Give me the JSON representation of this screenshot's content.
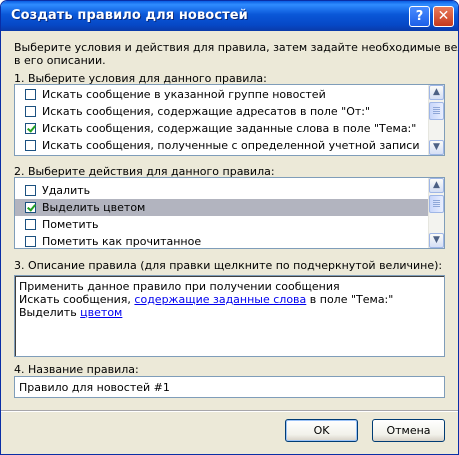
{
  "window": {
    "title": "Создать правило для новостей",
    "help_label": "?",
    "close_label": "✕"
  },
  "intro": {
    "line1": "Выберите условия и действия для правила, затем задайте необходимые величины",
    "line2": "в его описании."
  },
  "conditions": {
    "label": "1. Выберите условия для данного правила:",
    "items": [
      {
        "label": "Искать сообщение в указанной группе новостей",
        "checked": false
      },
      {
        "label": "Искать сообщения, содержащие адресатов в поле \"От:\"",
        "checked": false
      },
      {
        "label": "Искать сообщения, содержащие заданные слова в поле \"Тема:\"",
        "checked": true
      },
      {
        "label": "Искать сообщения, полученные с определенной учетной записи",
        "checked": false
      }
    ]
  },
  "actions": {
    "label": "2. Выберите действия для данного правила:",
    "items": [
      {
        "label": "Удалить",
        "checked": false
      },
      {
        "label": "Выделить цветом",
        "checked": true,
        "selected": true
      },
      {
        "label": "Пометить",
        "checked": false
      },
      {
        "label": "Пометить как прочитанное",
        "checked": false
      }
    ]
  },
  "description": {
    "label": "3. Описание правила (для правки щелкните по подчеркнутой величине):",
    "line1": "Применить данное правило при получении сообщения",
    "line2_prefix": "Искать сообщения, ",
    "line2_link": "содержащие заданные слова",
    "line2_suffix": " в поле \"Тема:\"",
    "line3_prefix": "Выделить ",
    "line3_link": "цветом"
  },
  "rule_name": {
    "label": "4. Название правила:",
    "value": "Правило для новостей #1"
  },
  "buttons": {
    "ok": "OK",
    "cancel": "Отмена"
  },
  "icons": {
    "scroll_up": "▲",
    "scroll_down": "▼"
  }
}
